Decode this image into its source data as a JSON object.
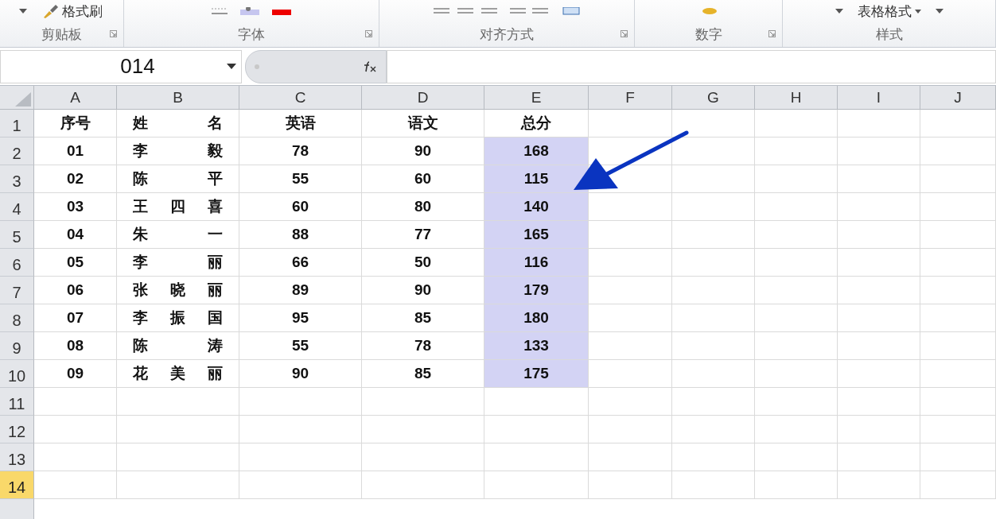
{
  "ribbon": {
    "groups": [
      {
        "label": "剪贴板",
        "button": "格式刷",
        "launcher": true
      },
      {
        "label": "字体",
        "launcher": true
      },
      {
        "label": "对齐方式",
        "launcher": true
      },
      {
        "label": "数字",
        "launcher": true
      },
      {
        "label": "样式",
        "button": "表格格式",
        "launcher": false
      }
    ]
  },
  "formula_bar": {
    "name_box": "014"
  },
  "sheet": {
    "columns": [
      "A",
      "B",
      "C",
      "D",
      "E",
      "F",
      "G",
      "H",
      "I",
      "J"
    ],
    "rows": [
      {
        "number": "1",
        "selected": false,
        "total_selected": false,
        "cells": [
          "序号",
          "姓名",
          "英语",
          "语文",
          "总分"
        ]
      },
      {
        "number": "2",
        "selected": false,
        "total_selected": true,
        "cells": [
          "01",
          "李 毅",
          "78",
          "90",
          "168"
        ]
      },
      {
        "number": "3",
        "selected": false,
        "total_selected": true,
        "cells": [
          "02",
          "陈 平",
          "55",
          "60",
          "115"
        ]
      },
      {
        "number": "4",
        "selected": false,
        "total_selected": true,
        "cells": [
          "03",
          "王 四 喜",
          "60",
          "80",
          "140"
        ]
      },
      {
        "number": "5",
        "selected": false,
        "total_selected": true,
        "cells": [
          "04",
          "朱 一",
          "88",
          "77",
          "165"
        ]
      },
      {
        "number": "6",
        "selected": false,
        "total_selected": true,
        "cells": [
          "05",
          "李 丽",
          "66",
          "50",
          "116"
        ]
      },
      {
        "number": "7",
        "selected": false,
        "total_selected": true,
        "cells": [
          "06",
          "张 晓 丽",
          "89",
          "90",
          "179"
        ]
      },
      {
        "number": "8",
        "selected": false,
        "total_selected": true,
        "cells": [
          "07",
          "李 振 国",
          "95",
          "85",
          "180"
        ]
      },
      {
        "number": "9",
        "selected": false,
        "total_selected": true,
        "cells": [
          "08",
          "陈 涛",
          "55",
          "78",
          "133"
        ]
      },
      {
        "number": "10",
        "selected": false,
        "total_selected": true,
        "cells": [
          "09",
          "花 美 丽",
          "90",
          "85",
          "175"
        ]
      },
      {
        "number": "11",
        "selected": false,
        "total_selected": false,
        "cells": []
      },
      {
        "number": "12",
        "selected": false,
        "total_selected": false,
        "cells": []
      },
      {
        "number": "13",
        "selected": false,
        "total_selected": false,
        "cells": []
      },
      {
        "number": "14",
        "selected": true,
        "total_selected": false,
        "cells": []
      }
    ]
  }
}
